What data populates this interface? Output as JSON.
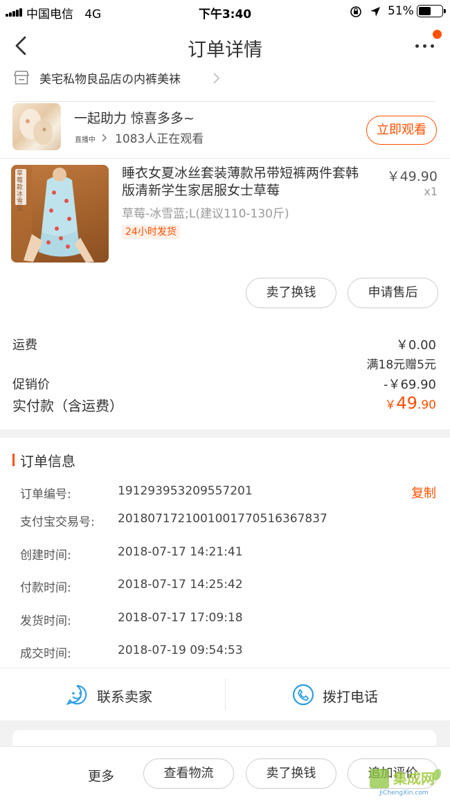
{
  "status_bar": {
    "carrier": "中国电信",
    "network": "4G",
    "time": "下午3:40",
    "battery_pct": "51%"
  },
  "nav": {
    "title": "订单详情"
  },
  "shop": {
    "name": "美宅私物良品店の内裤美袜"
  },
  "live": {
    "title": "一起助力 惊喜多多~",
    "status_tag": "直播中",
    "viewers": "1083人正在观看",
    "watch_button": "立即观看"
  },
  "product": {
    "title": "睡衣女夏冰丝套装薄款吊带短裤两件套韩版清新学生家居服女士草莓",
    "price": "￥49.90",
    "quantity": "x1",
    "sku": "草莓-冰雪蓝;L(建议110-130斤)",
    "tag": "24小时发货",
    "thumb_caption": "草莓款 冰雪蓝"
  },
  "item_actions": {
    "sell": "卖了换钱",
    "after_sale": "申请售后"
  },
  "fees": {
    "shipping_label": "运费",
    "shipping_value": "￥0.00",
    "shipping_note": "满18元赠5元",
    "promo_label": "促销价",
    "promo_value": "-￥69.90",
    "paid_label": "实付款（含运费）",
    "paid_currency": "￥",
    "paid_int": "49",
    "paid_dec": ".90"
  },
  "order_info": {
    "title": "订单信息",
    "copy": "复制",
    "rows": [
      {
        "label": "订单编号:",
        "value": "191293953209557201"
      },
      {
        "label": "支付宝交易号:",
        "value": "2018071721001001770516367837"
      },
      {
        "label": "创建时间:",
        "value": "2018-07-17 14:21:41"
      },
      {
        "label": "付款时间:",
        "value": "2018-07-17 14:25:42"
      },
      {
        "label": "发货时间:",
        "value": "2018-07-17 17:09:18"
      },
      {
        "label": "成交时间:",
        "value": "2018-07-19 09:54:53"
      }
    ]
  },
  "contact": {
    "seller": "联系卖家",
    "call": "拨打电话"
  },
  "bottom_bar": {
    "more": "更多",
    "logistics": "查看物流",
    "sell": "卖了换钱",
    "review": "追加评价"
  },
  "watermark": {
    "text": "集成网",
    "url": "JiChengXin.com"
  },
  "colors": {
    "accent": "#ff5000",
    "text": "#333333",
    "muted": "#999999",
    "background": "#f2f2f2"
  }
}
